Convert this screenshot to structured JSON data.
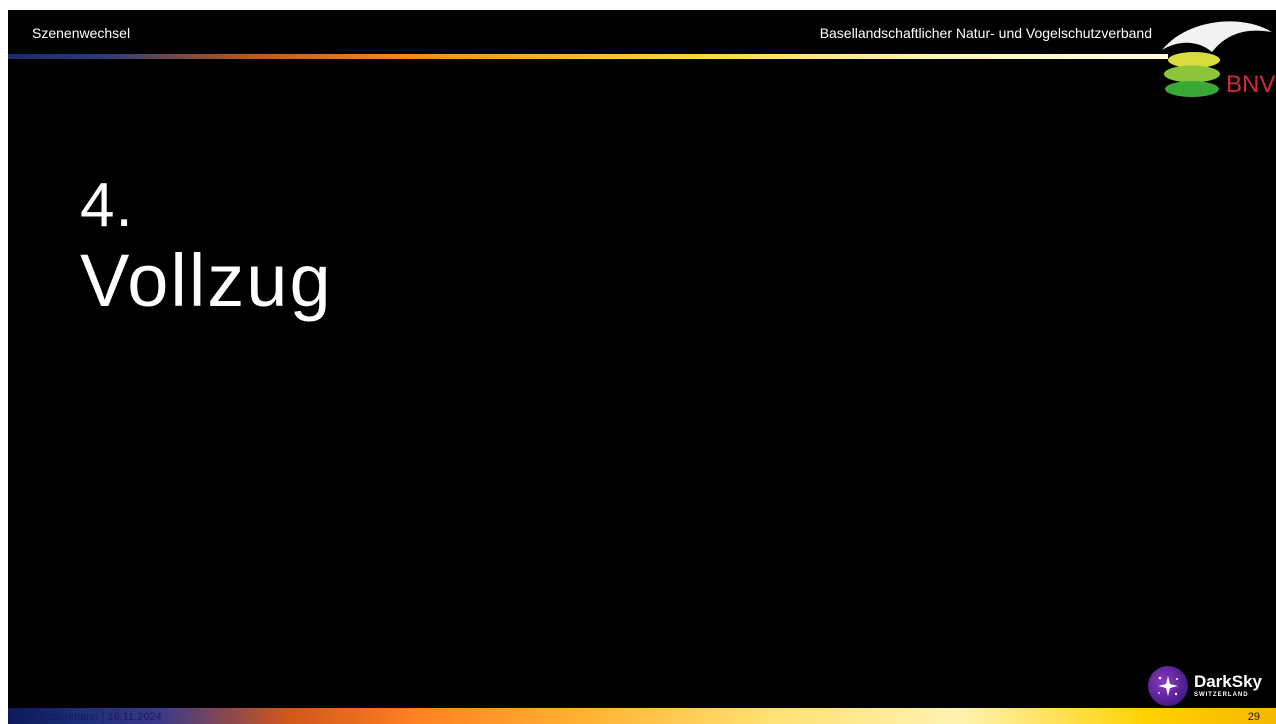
{
  "header": {
    "section_label": "Szenenwechsel",
    "organization": "Basellandschaftlicher Natur- und Vogelschutzverband"
  },
  "logo": {
    "text": "BNV",
    "icon": "bnv-bird-leaves-logo"
  },
  "slide": {
    "number": "4.",
    "title": "Vollzug"
  },
  "footer": {
    "copyright": "© Bodenmann | 16.11.2024",
    "page_number": "29"
  },
  "partner_logo": {
    "name": "DarkSky",
    "subtitle": "SWITZERLAND",
    "icon": "darksky-star-badge-icon"
  },
  "colors": {
    "background": "#000000",
    "text": "#ffffff",
    "bnv_red": "#d2283c",
    "leaf_green": "#39a935",
    "leaf_yellow": "#c8d234"
  }
}
